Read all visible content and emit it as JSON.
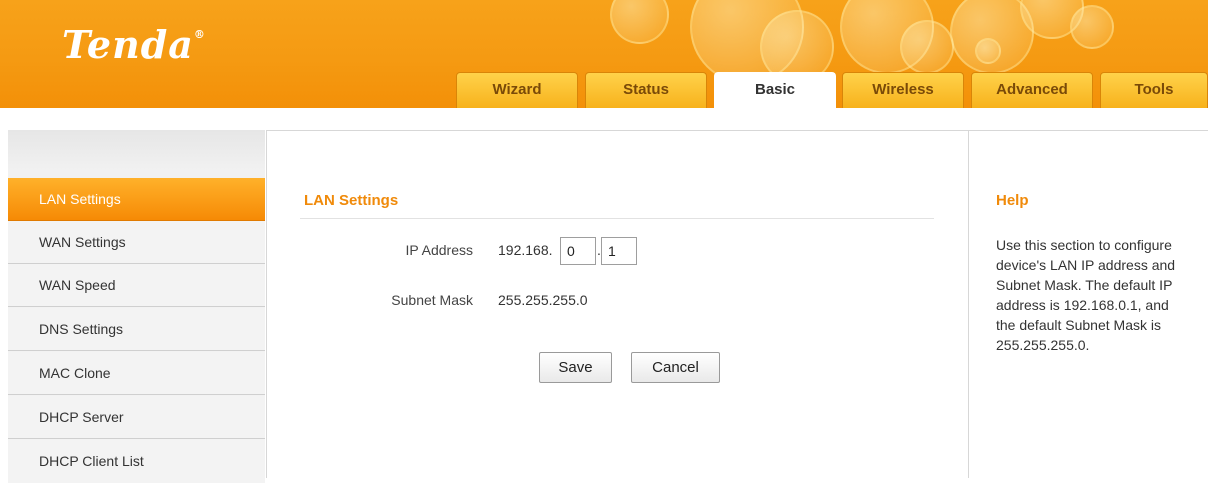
{
  "header": {
    "logo": "Tenda",
    "logo_mark": "®"
  },
  "tabs": [
    {
      "label": "Wizard",
      "active": false
    },
    {
      "label": "Status",
      "active": false
    },
    {
      "label": "Basic",
      "active": true
    },
    {
      "label": "Wireless",
      "active": false
    },
    {
      "label": "Advanced",
      "active": false
    },
    {
      "label": "Tools",
      "active": false
    }
  ],
  "sidebar": {
    "items": [
      {
        "label": "LAN Settings",
        "active": true
      },
      {
        "label": "WAN Settings"
      },
      {
        "label": "WAN Speed"
      },
      {
        "label": "DNS Settings"
      },
      {
        "label": "MAC Clone"
      },
      {
        "label": "DHCP Server"
      },
      {
        "label": "DHCP Client List"
      }
    ]
  },
  "main": {
    "title": "LAN Settings",
    "ip_label": "IP Address",
    "ip_prefix": "192.168.",
    "ip_third": "0",
    "ip_dot": ".",
    "ip_fourth": "1",
    "mask_label": "Subnet Mask",
    "mask_value": "255.255.255.0",
    "save_label": "Save",
    "cancel_label": "Cancel"
  },
  "help": {
    "title": "Help",
    "text": "Use this section to configure device's LAN IP address and Subnet Mask. The default IP address is 192.168.0.1, and the default Subnet Mask is 255.255.255.0."
  },
  "colors": {
    "brand": "#f59a12",
    "accent": "#f08a0a"
  }
}
